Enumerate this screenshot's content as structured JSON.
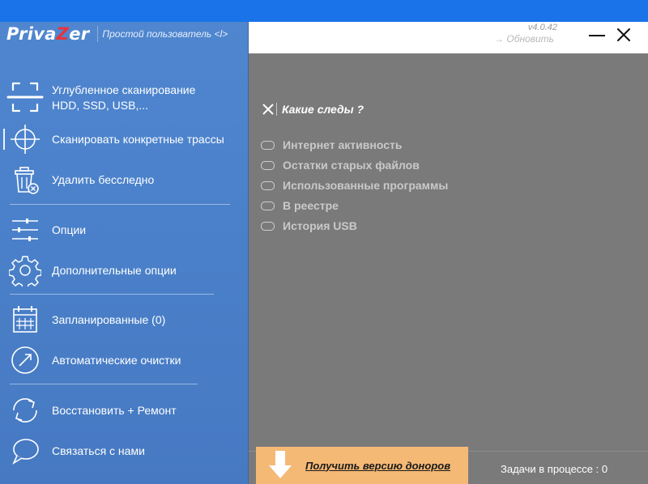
{
  "app": {
    "logo_prefix": "Priva",
    "logo_z": "Z",
    "logo_suffix": "er",
    "user_mode": "Простой пользователь <l>"
  },
  "titlebar": {
    "version": "v4.0.42",
    "update": "→ Обновить"
  },
  "sidebar": {
    "items": [
      {
        "label_line1": "Углубленное сканирование",
        "label_line2": "HDD, SSD, USB,...",
        "icon": "scan-frame-icon"
      },
      {
        "label": "Сканировать конкретные трассы",
        "icon": "crosshair-icon"
      },
      {
        "label": "Удалить бесследно",
        "icon": "trash-icon"
      },
      {
        "label": "Опции",
        "icon": "sliders-icon"
      },
      {
        "label": "Дополнительные опции",
        "icon": "gear-icon"
      },
      {
        "label": "Запланированные (0)",
        "icon": "calendar-icon"
      },
      {
        "label": "Автоматические очистки",
        "icon": "auto-arrow-icon"
      },
      {
        "label": "Восстановить + Ремонт",
        "icon": "refresh-icon"
      },
      {
        "label": "Связаться с нами",
        "icon": "chat-bubble-icon"
      }
    ]
  },
  "main": {
    "section_title": "Какие следы ?",
    "options": [
      "Интернет активность",
      "Остатки старых файлов",
      "Использованные программы",
      "В реестре",
      "История USB"
    ],
    "donor_link": "Получить версию доноров",
    "tasks": "Задачи в процессе : 0"
  },
  "colors": {
    "sidebar": "#4a80c9",
    "main_bg": "#7a7a7a",
    "donor_bg": "#f5b976",
    "logo_accent": "#e8343a",
    "desktop": "#1a73e8"
  }
}
